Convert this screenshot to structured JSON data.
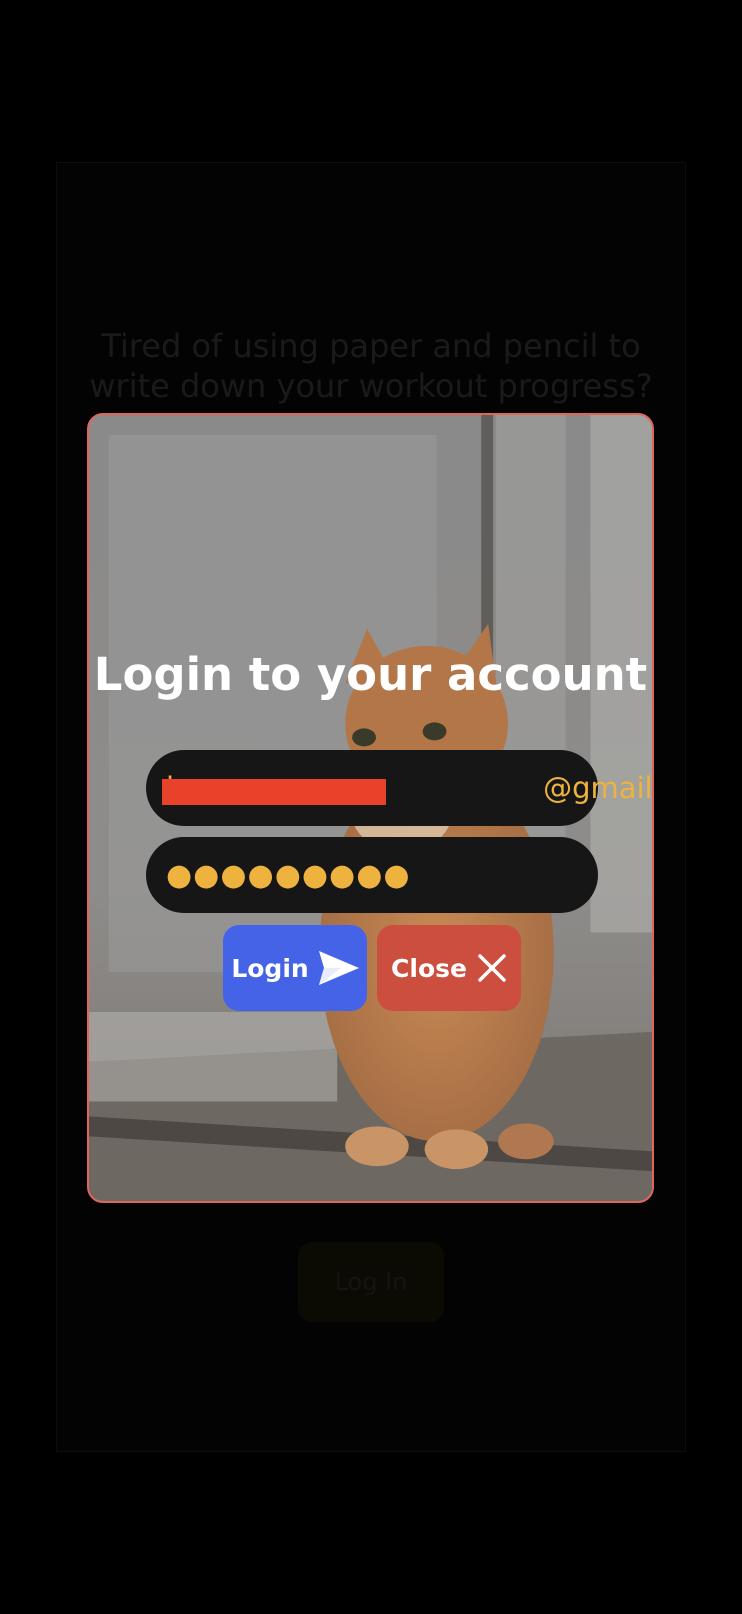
{
  "background": {
    "tagline": "Tired of using paper and pencil to write down your workout progress?",
    "login_button_label": "Log In"
  },
  "modal": {
    "title": "Login to your account",
    "email_value": "j                    @gmail.com",
    "password_value": "●●●●●●●●●",
    "login_label": "Login",
    "close_label": "Close",
    "login_icon": "send-icon",
    "close_icon": "close-icon"
  },
  "colors": {
    "border": "#e0665c",
    "login_button": "#4563e6",
    "close_button": "#cb4e3f",
    "field_text": "#eeb23f",
    "field_bg": "#161616",
    "redaction": "#e8432a"
  }
}
